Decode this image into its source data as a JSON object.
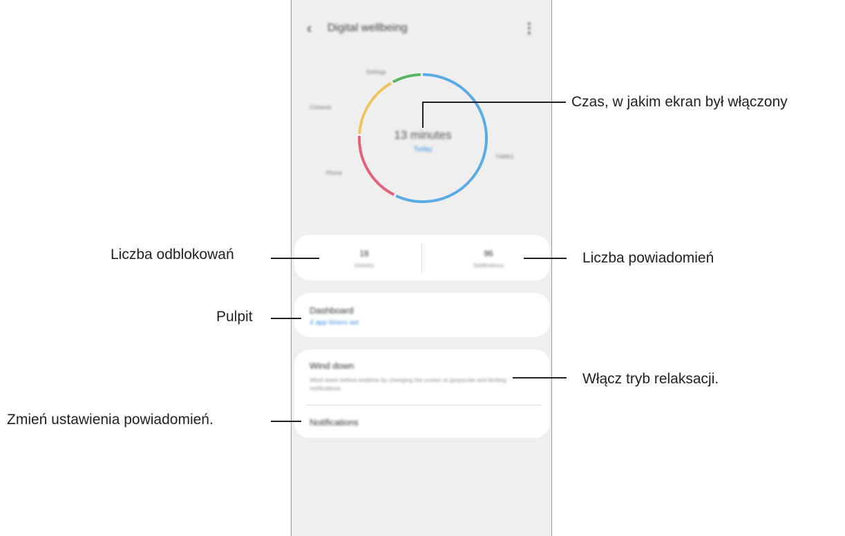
{
  "app": {
    "back_icon": "‹",
    "title": "Digital wellbeing",
    "more_icon": "⋮"
  },
  "usage": {
    "time": "13 minutes",
    "link": "Today",
    "segment_labels": [
      "Gallery",
      "Phone",
      "Contacts",
      "Settings"
    ],
    "segment_colors": [
      "#5aabe3",
      "#e5607a",
      "#f0c45c",
      "#58b55e"
    ]
  },
  "stats": {
    "unlocks_value": "18",
    "unlocks_label": "Unlocks",
    "notifications_value": "96",
    "notifications_label": "Notifications"
  },
  "dashboard": {
    "title": "Dashboard",
    "link": "4 app timers set"
  },
  "wind_down": {
    "title": "Wind down",
    "description": "Wind down before bedtime by changing the screen to grayscale and limiting notifications.",
    "notifications_title": "Notifications"
  },
  "callouts": {
    "screen_time": "Czas, w jakim ekran był włączony",
    "unlocks": "Liczba odblokowań",
    "notifications": "Liczba powiadomień",
    "dashboard": "Pulpit",
    "wind_down": "Włącz tryb relaksacji.",
    "notification_settings": "Zmień ustawienia powiadomień."
  }
}
